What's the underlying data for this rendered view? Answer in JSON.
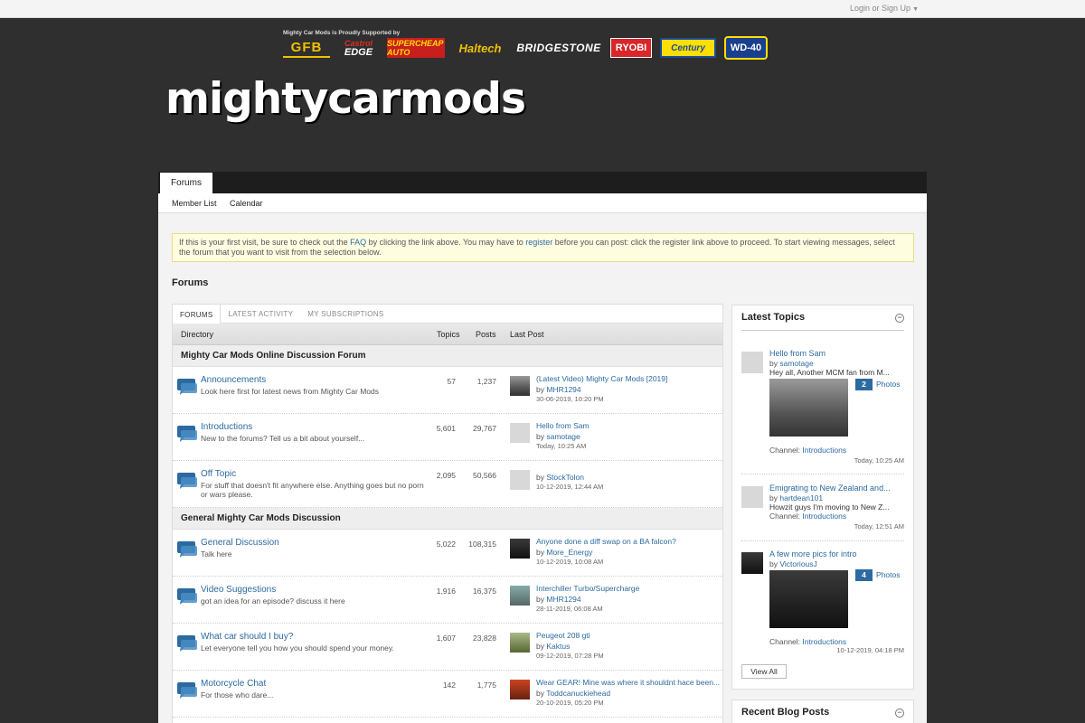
{
  "topbar": {
    "login_label": "Login or Sign Up",
    "login_caret": "▼"
  },
  "sponsors": {
    "caption": "Mighty Car Mods is Proudly Supported by",
    "logos": {
      "gfb": "GFB",
      "castrol_top": "Castrol",
      "castrol_bottom": "EDGE",
      "supercheap": "SUPERCHEAP AUTO",
      "haltech": "Haltech",
      "bridgestone": "BRIDGESTONE",
      "ryobi": "RYOBI",
      "century": "Century",
      "wd40": "WD-40"
    }
  },
  "site": {
    "logo_text": "mightycarmods"
  },
  "nav": {
    "tab_forums": "Forums",
    "member_list": "Member List",
    "calendar": "Calendar"
  },
  "notice": {
    "part1": "If this is your first visit, be sure to check out the ",
    "faq": "FAQ",
    "part2": " by clicking the link above. You may have to ",
    "register": "register",
    "part3": " before you can post: click the register link above to proceed. To start viewing messages, select the forum that you want to visit from the selection below."
  },
  "page_title": "Forums",
  "forum_tabs": [
    "FORUMS",
    "LATEST ACTIVITY",
    "MY SUBSCRIPTIONS"
  ],
  "columns": {
    "directory": "Directory",
    "topics": "Topics",
    "posts": "Posts",
    "last_post": "Last Post"
  },
  "categories": [
    {
      "title": "Mighty Car Mods Online Discussion Forum",
      "forums": [
        {
          "name": "Announcements",
          "desc": "Look here first for latest news from Mighty Car Mods",
          "topics": "57",
          "posts": "1,237",
          "last_title": "(Latest Video) Mighty Car Mods [2019]",
          "by_label": "by",
          "last_user": "MHR1294",
          "last_date": "30-06-2019, 10:20 PM",
          "thumb": "car1"
        },
        {
          "name": "Introductions",
          "desc": "New to the forums? Tell us a bit about yourself...",
          "topics": "5,601",
          "posts": "29,767",
          "last_title": "Hello from Sam",
          "by_label": "by",
          "last_user": "samotage",
          "last_date": "Today, 10:25 AM",
          "thumb": "default"
        },
        {
          "name": "Off Topic",
          "desc": "For stuff that doesn't fit anywhere else. Anything goes but no porn or wars please.",
          "topics": "2,095",
          "posts": "50,566",
          "last_title": "",
          "by_label": "by",
          "last_user": "StockTolon",
          "last_date": "10-12-2019, 12:44 AM",
          "thumb": "default"
        }
      ]
    },
    {
      "title": "General Mighty Car Mods Discussion",
      "forums": [
        {
          "name": "General Discussion",
          "desc": "Talk here",
          "topics": "5,022",
          "posts": "108,315",
          "last_title": "Anyone done a diff swap on a BA falcon?",
          "by_label": "by",
          "last_user": "More_Energy",
          "last_date": "10-12-2019, 10:08 AM",
          "thumb": "car2"
        },
        {
          "name": "Video Suggestions",
          "desc": "got an idea for an episode? discuss it here",
          "topics": "1,916",
          "posts": "16,375",
          "last_title": "Interchiller Turbo/Supercharge",
          "by_label": "by",
          "last_user": "MHR1294",
          "last_date": "28-11-2019, 06:08 AM",
          "thumb": "car3"
        },
        {
          "name": "What car should I buy?",
          "desc": "Let everyone tell you how you should spend your money.",
          "topics": "1,607",
          "posts": "23,828",
          "last_title": "Peugeot 208 gti",
          "by_label": "by",
          "last_user": "Kaktus",
          "last_date": "09-12-2019, 07:28 PM",
          "thumb": "car4"
        },
        {
          "name": "Motorcycle Chat",
          "desc": "For those who dare...",
          "topics": "142",
          "posts": "1,775",
          "last_title": "Wear GEAR! Mine was where it shouldnt hace been...",
          "by_label": "by",
          "last_user": "Toddcanuckiehead",
          "last_date": "20-10-2019, 05:20 PM",
          "thumb": "car5"
        }
      ]
    }
  ],
  "latest_topics": {
    "heading": "Latest Topics",
    "collapse_symbol": "−",
    "items": [
      {
        "title": "Hello from Sam",
        "by_label": "by",
        "user": "samotage",
        "excerpt": "Hey all, Another MCM fan from M...",
        "photos_count": "2",
        "photos_label": "Photos",
        "channel_label": "Channel:",
        "channel": "Introductions",
        "date": "Today, 10:25 AM"
      },
      {
        "title": "Emigrating to New Zealand and...",
        "by_label": "by",
        "user": "hartdean101",
        "excerpt": "Howzit guys I'm moving to New Z...",
        "channel_label": "Channel:",
        "channel": "Introductions",
        "date": "Today, 12:51 AM"
      },
      {
        "title": "A few more pics for intro",
        "by_label": "by",
        "user": "VictoriousJ",
        "photos_count": "4",
        "photos_label": "Photos",
        "channel_label": "Channel:",
        "channel": "Introductions",
        "date": "10-12-2019, 04:18 PM"
      }
    ],
    "view_all": "View All"
  },
  "recent_blog": {
    "heading": "Recent Blog Posts",
    "collapse_symbol": "−"
  },
  "colors": {
    "link": "#2c6aa0",
    "header_bg": "#2f2f2f",
    "notice_bg": "#fffde0",
    "badge": "#2c6aa0"
  }
}
